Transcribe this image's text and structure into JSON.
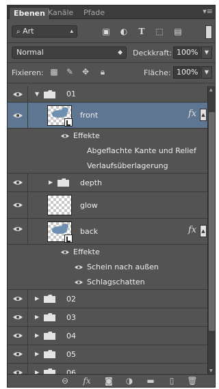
{
  "tabs": [
    {
      "label": "Ebenen",
      "active": true
    },
    {
      "label": "Kanäle",
      "active": false
    },
    {
      "label": "Pfade",
      "active": false
    }
  ],
  "panel_menu_icon": "panel-menu-icon",
  "filter": {
    "kind_label": "Art",
    "icons": [
      "pixel-filter-icon",
      "adjustment-filter-icon",
      "type-filter-icon",
      "shape-filter-icon",
      "smart-object-filter-icon"
    ],
    "type_glyph": "T"
  },
  "blend": {
    "mode": "Normal",
    "opacity_label": "Deckkraft:",
    "opacity_value": "100%"
  },
  "lock": {
    "label": "Fixieren:",
    "fill_label": "Fläche:",
    "fill_value": "100%"
  },
  "layers": {
    "group01": {
      "name": "01"
    },
    "front": {
      "name": "front",
      "fx": "fx",
      "effects_label": "Effekte",
      "effects": [
        "Abgeflachte Kante und Relief",
        "Verlaufsüberlagerung"
      ]
    },
    "depth": {
      "name": "depth"
    },
    "glow": {
      "name": "glow"
    },
    "back": {
      "name": "back",
      "fx": "fx",
      "effects_label": "Effekte",
      "effects": [
        "Schein nach außen",
        "Schlagschatten"
      ]
    },
    "groups": [
      "02",
      "03",
      "04",
      "05",
      "06"
    ]
  },
  "bottom_icons": [
    "link-layers-icon",
    "fx-icon",
    "add-mask-icon",
    "adjustment-layer-icon",
    "new-group-icon",
    "new-layer-icon",
    "delete-icon"
  ],
  "colors": {
    "panel": "#535353",
    "selected": "#5e7691"
  }
}
